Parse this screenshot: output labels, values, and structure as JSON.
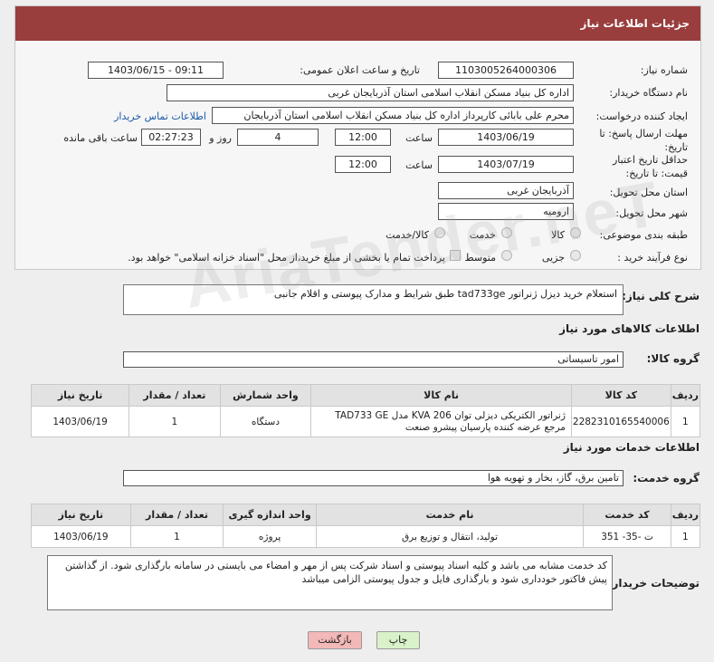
{
  "header": {
    "title": "جزئیات اطلاعات نیاز"
  },
  "fields": {
    "need_number_label": "شماره نیاز:",
    "need_number": "1103005264000306",
    "announce_label": "تاریخ و ساعت اعلان عمومی:",
    "announce_value": "1403/06/15 - 09:11",
    "buyer_label": "نام دستگاه خریدار:",
    "buyer_value": "اداره کل بنیاد مسکن انقلاب اسلامی استان آذربایجان غربی",
    "requester_label": "ایجاد کننده درخواست:",
    "requester_value": "محرم علی بابائی کارپرداز اداره کل بنیاد مسکن انقلاب اسلامی استان آذربایجان",
    "contact_link": "اطلاعات تماس خریدار",
    "deadline_label": "مهلت ارسال پاسخ: تا تاریخ:",
    "deadline_date": "1403/06/19",
    "time_label": "ساعت",
    "deadline_time": "12:00",
    "days_value": "4",
    "days_label": "روز و",
    "remaining_time": "02:27:23",
    "remaining_label": "ساعت باقی مانده",
    "validity_label": "حداقل تاریخ اعتبار قیمت: تا تاریخ:",
    "validity_date": "1403/07/19",
    "validity_time": "12:00",
    "province_label": "استان محل تحویل:",
    "province_value": "آذربایجان غربی",
    "city_label": "شهر محل تحویل:",
    "city_value": "ارومیه",
    "category_label": "طبقه بندی موضوعی:",
    "category_options": [
      "کالا",
      "خدمت",
      "کالا/خدمت"
    ],
    "process_label": "نوع فرآیند خرید :",
    "process_options": [
      "جزیی",
      "متوسط"
    ],
    "payment_note": "پرداخت تمام یا بخشی از مبلغ خرید،از محل \"اسناد خزانه اسلامی\" خواهد بود."
  },
  "description": {
    "label": "شرح کلی نیاز:",
    "value": "استعلام خرید دیزل ژنراتور tad733ge طبق شرایط و مدارک پیوستی و اقلام جانبی"
  },
  "goods": {
    "section_title": "اطلاعات کالاهای مورد نیاز",
    "group_label": "گروه کالا:",
    "group_value": "امور تاسیساتی",
    "headers": [
      "ردیف",
      "کد کالا",
      "نام کالا",
      "واحد شمارش",
      "تعداد / مقدار",
      "تاریخ نیاز"
    ],
    "rows": [
      {
        "row": "1",
        "code": "2282310165540006",
        "name": "ژنراتور الکتریکی دیزلی توان 206 KVA مدل TAD733 GE مرجع عرضه کننده پارسیان پیشرو صنعت",
        "unit": "دستگاه",
        "qty": "1",
        "date": "1403/06/19"
      }
    ]
  },
  "services": {
    "section_title": "اطلاعات خدمات مورد نیاز",
    "group_label": "گروه خدمت:",
    "group_value": "تامین برق، گاز، بخار و تهویه هوا",
    "headers": [
      "ردیف",
      "کد خدمت",
      "نام خدمت",
      "واحد اندازه گیری",
      "تعداد / مقدار",
      "تاریخ نیاز"
    ],
    "rows": [
      {
        "row": "1",
        "code": "ت -35- 351",
        "name": "تولید، انتقال و توزیع برق",
        "unit": "پروژه",
        "qty": "1",
        "date": "1403/06/19"
      }
    ]
  },
  "buyer_notes": {
    "label": "توضیحات خریدار:",
    "value": "کد خدمت مشابه می باشد و کلیه اسناد پیوستی و اسناد شرکت پس از مهر و امضاء می بایستی در سامانه بارگذاری شود. از گذاشتن پیش فاکتور خودداری شود و بارگذاری فایل و جدول پیوستی الزامی میباشد"
  },
  "buttons": {
    "print": "چاپ",
    "back": "بازگشت"
  },
  "watermark": "AriaTender.neT",
  "colors": {
    "header_bg": "#9a3d3d",
    "link": "#1a5aa8",
    "back_button_bg": "#f3b8b8",
    "print_button_bg": "#d9f2c9"
  }
}
